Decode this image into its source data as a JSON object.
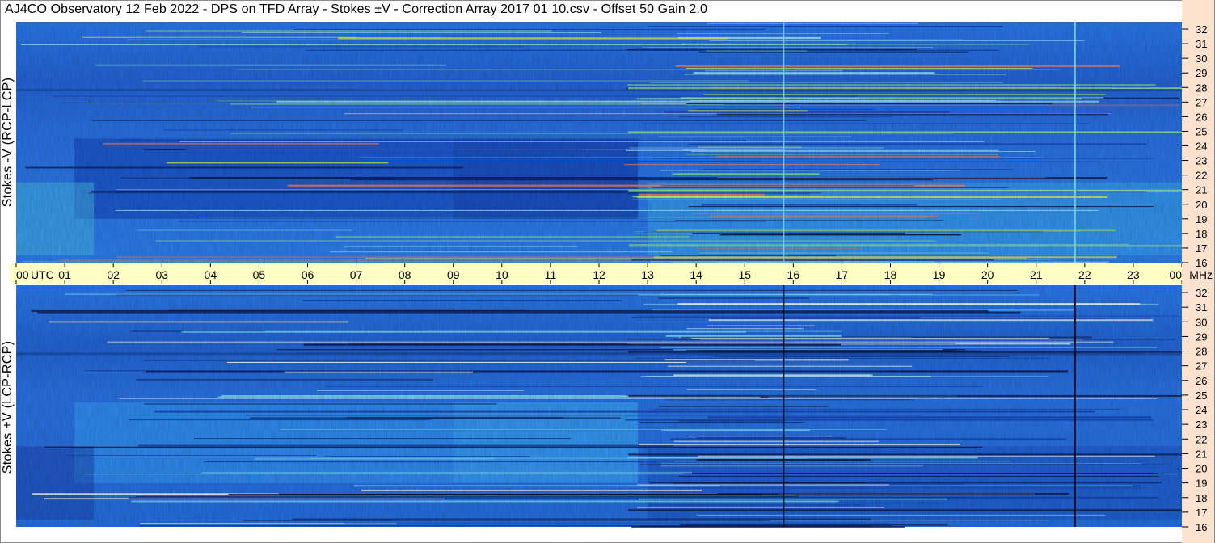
{
  "title": "AJ4CO Observatory  12 Feb 2022  -  DPS on TFD Array  -  Stokes ±V  -  Correction Array 2017 01 10.csv  -  Offset 50  Gain 2.0",
  "colors": {
    "band": "#ffffc4",
    "freq_axis_bg": "#fde2cf",
    "spectrogram_base": "#1f6fe8",
    "dark_line": "#0a1a50"
  },
  "chart_data": [
    {
      "type": "heatmap",
      "panel": "top",
      "ylabel": "Stokes -V  (RCP-LCP)",
      "y_ticks": [
        "32",
        "31",
        "30",
        "29",
        "28",
        "27",
        "26",
        "25",
        "24",
        "23",
        "22",
        "21",
        "20",
        "19",
        "18",
        "17",
        "16"
      ],
      "x_ticks": [
        "00",
        "01",
        "02",
        "03",
        "04",
        "05",
        "06",
        "07",
        "08",
        "09",
        "10",
        "11",
        "12",
        "13",
        "14",
        "15",
        "16",
        "17",
        "18",
        "19",
        "20",
        "21",
        "22",
        "23",
        "00"
      ],
      "x_unit": "UTC",
      "y_unit": "MHz",
      "x_range_hours": [
        0,
        24
      ],
      "y_range_mhz": [
        16,
        32.5
      ],
      "features": [
        {
          "kind": "vertical_line",
          "time_hours": 15.8,
          "tone": "bright"
        },
        {
          "kind": "vertical_line",
          "time_hours": 21.8,
          "tone": "bright"
        },
        {
          "kind": "darker_block",
          "from_hours": 1.2,
          "to_hours": 12.8,
          "from_mhz": 19,
          "to_mhz": 24.5
        },
        {
          "kind": "enhanced_emission",
          "from_hours": 13,
          "to_hours": 24,
          "from_mhz": 16.5,
          "to_mhz": 21.5
        }
      ]
    },
    {
      "type": "heatmap",
      "panel": "bottom",
      "ylabel": "Stokes +V  (LCP-RCP)",
      "y_ticks": [
        "32",
        "31",
        "30",
        "29",
        "28",
        "27",
        "26",
        "25",
        "24",
        "23",
        "22",
        "21",
        "20",
        "19",
        "18",
        "17",
        "16"
      ],
      "x_range_hours": [
        0,
        24
      ],
      "y_range_mhz": [
        16,
        32.5
      ],
      "features": [
        {
          "kind": "vertical_line",
          "time_hours": 15.8,
          "tone": "dark"
        },
        {
          "kind": "vertical_line",
          "time_hours": 21.8,
          "tone": "dark"
        },
        {
          "kind": "brighter_block",
          "from_hours": 1.2,
          "to_hours": 12.8,
          "from_mhz": 19,
          "to_mhz": 24.5
        },
        {
          "kind": "darker_emission",
          "from_hours": 13,
          "to_hours": 24,
          "from_mhz": 16.5,
          "to_mhz": 21.5
        }
      ]
    }
  ]
}
